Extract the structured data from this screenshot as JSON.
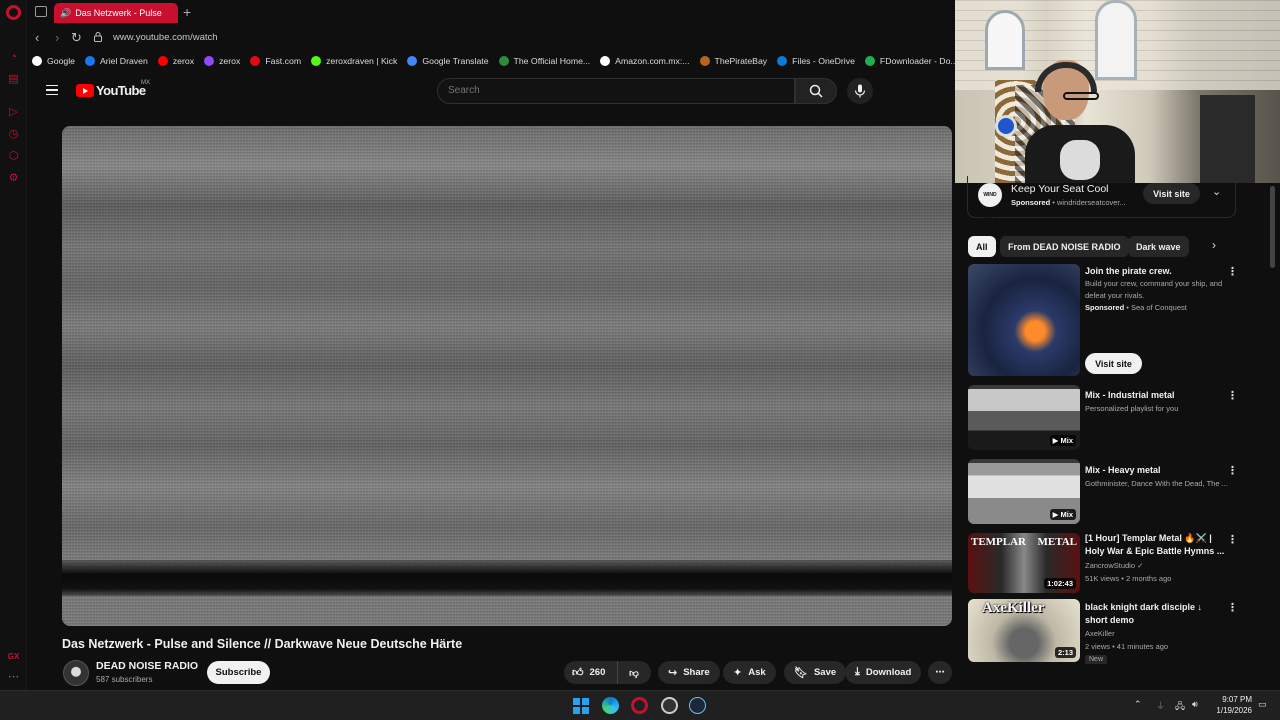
{
  "browser": {
    "tab_title": "Das Netzwerk - Pulse",
    "url": "www.youtube.com/watch",
    "bookmarks": [
      {
        "label": "Google",
        "icon": "google-icon",
        "color": "#ffffff"
      },
      {
        "label": "Ariel Draven",
        "icon": "facebook-icon",
        "color": "#1877f2"
      },
      {
        "label": "zerox",
        "icon": "youtube-icon",
        "color": "#ff0000"
      },
      {
        "label": "zerox",
        "icon": "twitch-icon",
        "color": "#9146ff"
      },
      {
        "label": "Fast.com",
        "icon": "fast-icon",
        "color": "#e50914"
      },
      {
        "label": "zeroxdraven | Kick",
        "icon": "kick-icon",
        "color": "#53fc18"
      },
      {
        "label": "Google Translate",
        "icon": "translate-icon",
        "color": "#4285f4"
      },
      {
        "label": "The Official Home...",
        "icon": "home-icon",
        "color": "#2d8c3c"
      },
      {
        "label": "Amazon.com.mx:...",
        "icon": "amazon-icon",
        "color": "#ffffff"
      },
      {
        "label": "ThePirateBay",
        "icon": "pirate-icon",
        "color": "#b5651d"
      },
      {
        "label": "Files - OneDrive",
        "icon": "onedrive-icon",
        "color": "#0a7bd7"
      },
      {
        "label": "FDownloader - Do...",
        "icon": "download-icon",
        "color": "#22b04e"
      }
    ]
  },
  "youtube": {
    "logo_text": "YouTube",
    "country": "MX",
    "search_placeholder": "Search"
  },
  "video": {
    "title": "Das Netzwerk - Pulse and Silence // Darkwave Neue Deutsche Härte",
    "channel": "DEAD NOISE RADIO",
    "subscribers": "587 subscribers",
    "subscribe_label": "Subscribe",
    "likes": "260",
    "share_label": "Share",
    "ask_label": "Ask",
    "save_label": "Save",
    "download_label": "Download"
  },
  "sidebar": {
    "ad": {
      "logo": "WIND RIDER",
      "title": "Keep Your Seat Cool",
      "sponsored": "Sponsored",
      "domain": "windriderseatcover...",
      "visit_label": "Visit site"
    },
    "chips": [
      "All",
      "From DEAD NOISE RADIO",
      "Dark wave"
    ],
    "items": [
      {
        "title": "Join the pirate crew.",
        "desc": "Build your crew, command your ship, and defeat your rivals.",
        "sponsored": "Sponsored",
        "meta": "Sea of Conquest",
        "visit_label": "Visit site"
      },
      {
        "title": "Mix - Industrial metal",
        "meta": "Personalized playlist for you",
        "badge": "Mix"
      },
      {
        "title": "Mix - Heavy metal",
        "meta": "Gothminister, Dance With the Dead, The ...",
        "badge": "Mix"
      },
      {
        "title": "[1 Hour] Templar Metal 🔥⚔️ | Holy War & Epic Battle Hymns ...",
        "channel": "ZancrowStudio",
        "meta": "51K views • 2 months ago",
        "badge": "1:02:43",
        "thumb_text_left": "TEMPLAR",
        "thumb_text_right": "METAL"
      },
      {
        "title": "black knight dark disciple ↓ short demo",
        "channel": "AxeKiller",
        "meta": "2 views • 41 minutes ago",
        "badge": "2:13",
        "new": "New",
        "thumb_text": "AxeKiller"
      }
    ]
  },
  "taskbar": {
    "time": "9:07 PM",
    "date": "1/19/2026"
  },
  "colors": {
    "accent": "#c8102e",
    "youtube_red": "#ff0000",
    "bg": "#0f0f0f"
  }
}
